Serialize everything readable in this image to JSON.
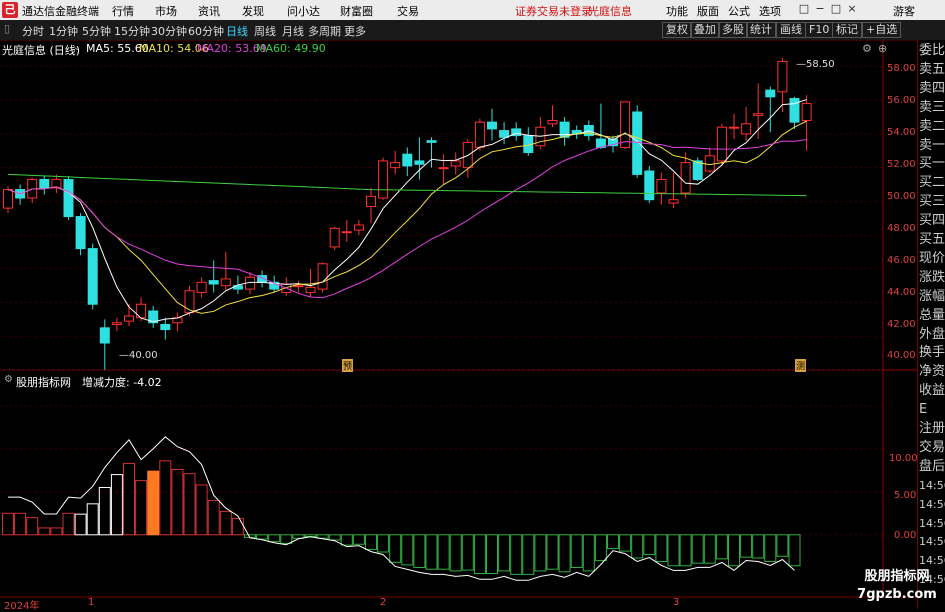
{
  "app": {
    "logo": "己",
    "title": "通达信金融终端",
    "menu": [
      "行情",
      "市场",
      "资讯",
      "发现",
      "问小达",
      "财富圈",
      "交易"
    ],
    "warning": "证券交易未登录",
    "stock_name_top": "光庭信息",
    "right_menu": [
      "功能",
      "版面",
      "公式",
      "选项"
    ],
    "guest": "游客",
    "window_buttons": [
      "□",
      "−",
      "□",
      "×"
    ]
  },
  "toolbar": {
    "items": [
      "分时",
      "1分钟",
      "5分钟",
      "15分钟",
      "30分钟",
      "60分钟",
      "日线",
      "周线",
      "月线",
      "多周期",
      "更多"
    ],
    "active": "日线",
    "right_buttons": [
      "复权",
      "叠加",
      "多股",
      "统计",
      "画线",
      "F10",
      "标记",
      "+自选"
    ]
  },
  "price_chart": {
    "title": "光庭信息 (日线)",
    "ma_legend": [
      {
        "label": "MA5: 55.60",
        "color": "#ffffff"
      },
      {
        "label": "MA10: 54.06",
        "color": "#f0e040"
      },
      {
        "label": "MA20: 53.69",
        "color": "#e040e0"
      },
      {
        "label": "MA60: 49.90",
        "color": "#40d040"
      }
    ],
    "y_ticks": [
      "58.00",
      "56.00",
      "54.00",
      "52.00",
      "50.00",
      "48.00",
      "46.00",
      "44.00",
      "42.00",
      "40.00"
    ],
    "high_label": "58.50",
    "low_label": "40.00",
    "markers": [
      "预",
      "测"
    ]
  },
  "indicator": {
    "title": "股朋指标网",
    "value_label": "增减力度: -4.02",
    "y_ticks": [
      "10.00",
      "5.00",
      "0.00"
    ]
  },
  "x_axis": [
    "2024年",
    "1",
    "2",
    "3"
  ],
  "right_panel": [
    "委比",
    "卖五",
    "卖四",
    "卖三",
    "卖二",
    "卖一",
    "买一",
    "买二",
    "买三",
    "买四",
    "买五",
    "现价",
    "涨跌",
    "涨幅",
    "总量",
    "外盘",
    "换手",
    "净资",
    "收益",
    "E",
    "注册",
    "交易",
    "盘后",
    "14:56",
    "14:56",
    "14:56",
    "14:56",
    "14:56",
    "14:56"
  ],
  "watermark": [
    "股朋指标网",
    "7gpzb.com"
  ],
  "chart_data": {
    "type": "candlestick",
    "series_ohlc": [
      [
        49.6,
        50.7,
        50.9,
        49.3
      ],
      [
        50.7,
        50.2,
        51.0,
        49.8
      ],
      [
        50.2,
        51.3,
        51.4,
        49.9
      ],
      [
        51.3,
        50.8,
        51.5,
        50.4
      ],
      [
        50.8,
        51.3,
        51.6,
        50.5
      ],
      [
        51.3,
        49.1,
        51.5,
        48.9
      ],
      [
        49.1,
        47.2,
        49.3,
        46.8
      ],
      [
        47.2,
        43.9,
        47.5,
        43.6
      ],
      [
        42.5,
        41.6,
        43.0,
        40.0
      ],
      [
        42.7,
        42.8,
        43.1,
        42.3
      ],
      [
        42.9,
        43.2,
        43.9,
        42.6
      ],
      [
        43.1,
        43.9,
        44.3,
        42.9
      ],
      [
        43.5,
        42.8,
        43.8,
        42.5
      ],
      [
        42.7,
        42.4,
        43.1,
        41.8
      ],
      [
        42.8,
        43.1,
        43.4,
        42.3
      ],
      [
        43.4,
        44.7,
        45.0,
        43.2
      ],
      [
        44.6,
        45.2,
        45.5,
        44.3
      ],
      [
        45.3,
        45.1,
        46.5,
        44.6
      ],
      [
        45.0,
        45.4,
        47.0,
        44.7
      ],
      [
        45.0,
        44.8,
        45.6,
        44.5
      ],
      [
        44.8,
        45.5,
        45.8,
        44.5
      ],
      [
        45.6,
        45.2,
        45.9,
        44.9
      ],
      [
        45.2,
        44.8,
        45.6,
        44.6
      ],
      [
        44.6,
        45.1,
        45.5,
        44.4
      ],
      [
        45.0,
        45.0,
        45.3,
        44.6
      ],
      [
        44.6,
        44.9,
        46.0,
        44.3
      ],
      [
        44.8,
        46.3,
        46.4,
        44.6
      ],
      [
        47.3,
        48.4,
        48.5,
        47.1
      ],
      [
        48.2,
        48.2,
        48.9,
        47.6
      ],
      [
        48.3,
        48.6,
        48.9,
        48.0
      ],
      [
        49.7,
        50.3,
        50.8,
        48.7
      ],
      [
        50.2,
        52.4,
        52.6,
        50.1
      ],
      [
        52.0,
        52.3,
        53.0,
        51.6
      ],
      [
        52.8,
        52.1,
        53.2,
        51.5
      ],
      [
        52.4,
        52.2,
        53.8,
        51.3
      ],
      [
        53.6,
        53.5,
        53.8,
        52.0
      ],
      [
        52.0,
        52.0,
        52.8,
        51.0
      ],
      [
        52.1,
        52.4,
        52.9,
        51.6
      ],
      [
        52.0,
        53.5,
        53.7,
        51.4
      ],
      [
        53.2,
        54.7,
        54.9,
        53.0
      ],
      [
        54.7,
        54.3,
        55.5,
        53.6
      ],
      [
        54.2,
        53.8,
        54.7,
        53.4
      ],
      [
        54.3,
        53.9,
        54.7,
        53.6
      ],
      [
        53.9,
        52.9,
        54.4,
        52.7
      ],
      [
        53.3,
        54.4,
        55.0,
        53.1
      ],
      [
        54.6,
        54.8,
        55.7,
        54.4
      ],
      [
        54.7,
        53.8,
        55.0,
        53.3
      ],
      [
        54.2,
        54.0,
        54.5,
        53.7
      ],
      [
        54.5,
        53.9,
        54.8,
        53.6
      ],
      [
        53.7,
        53.2,
        55.8,
        53.1
      ],
      [
        53.7,
        53.3,
        53.9,
        52.9
      ],
      [
        53.2,
        55.9,
        55.6,
        53.1
      ],
      [
        55.3,
        51.6,
        55.7,
        51.4
      ],
      [
        51.8,
        50.1,
        52.1,
        49.9
      ],
      [
        50.5,
        51.3,
        51.7,
        49.8
      ],
      [
        49.9,
        50.1,
        51.7,
        49.6
      ],
      [
        50.5,
        52.3,
        52.9,
        50.2
      ],
      [
        52.4,
        51.3,
        52.6,
        51.2
      ],
      [
        51.8,
        52.7,
        53.2,
        51.7
      ],
      [
        52.4,
        54.4,
        54.6,
        52.1
      ],
      [
        54.4,
        54.4,
        55.2,
        53.7
      ],
      [
        54.0,
        54.6,
        55.6,
        53.6
      ],
      [
        55.1,
        55.2,
        57.0,
        53.7
      ],
      [
        56.6,
        56.2,
        56.8,
        54.1
      ],
      [
        56.5,
        58.3,
        58.5,
        55.3
      ],
      [
        56.1,
        54.7,
        56.2,
        54.3
      ],
      [
        54.8,
        55.8,
        56.3,
        53.0
      ]
    ],
    "ma_periods": [
      5,
      10,
      20,
      60
    ],
    "y_range": [
      40,
      58.8
    ],
    "indicator_values": [
      2.5,
      2.5,
      2.0,
      0.8,
      0.8,
      2.5,
      2.4,
      3.6,
      5.5,
      7.0,
      8.3,
      6.3,
      7.4,
      8.6,
      7.6,
      7.1,
      5.8,
      4.0,
      2.7,
      1.9,
      -0.3,
      -0.5,
      -0.8,
      -1.0,
      -0.4,
      -0.2,
      -0.4,
      -0.6,
      -1.2,
      -1.1,
      -1.7,
      -2.0,
      -3.2,
      -3.5,
      -3.8,
      -4.0,
      -4.0,
      -4.2,
      -4.1,
      -4.5,
      -4.5,
      -4.2,
      -4.6,
      -4.6,
      -4.2,
      -4.0,
      -4.3,
      -3.8,
      -4.2,
      -3.0,
      -1.6,
      -1.9,
      -2.7,
      -2.3,
      -3.1,
      -3.6,
      -3.6,
      -3.3,
      -3.3,
      -2.8,
      -3.6,
      -2.6,
      -2.7,
      -3.1,
      -2.5,
      -3.6
    ],
    "indicator_range": [
      -7,
      18
    ]
  }
}
